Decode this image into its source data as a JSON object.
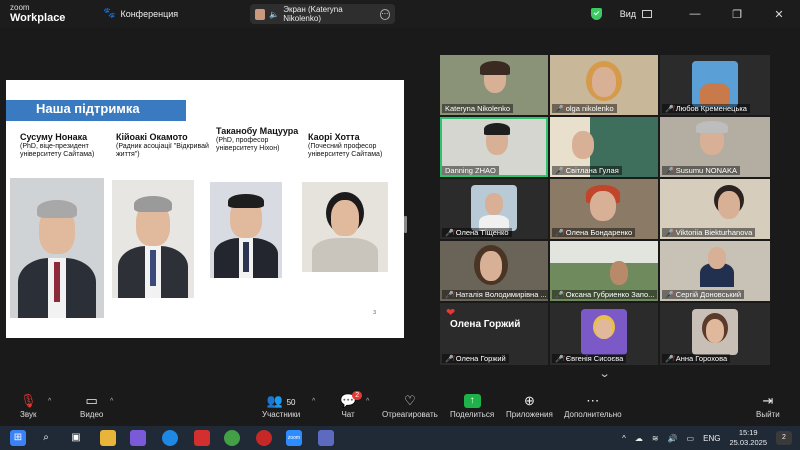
{
  "app": {
    "logo_top": "zoom",
    "logo_bottom": "Workplace",
    "meeting_label": "Конференция"
  },
  "share_pill": {
    "label": "Экран (Kateryna Nikolenko)",
    "more": "⋯"
  },
  "titlebar": {
    "view_label": "Вид"
  },
  "slide": {
    "title": "Наша підтримка",
    "page": "3",
    "people": [
      {
        "name": "Сусуму Нонака",
        "desc": "(PhD, віце-президент університету Сайтама)"
      },
      {
        "name": "Кійоакі Окамото",
        "desc": "(Радник асоціації \"Відкривай життя\")"
      },
      {
        "name": "Таканобу Мацуура",
        "desc": "(PhD, професор університету Ніхон)"
      },
      {
        "name": "Каорі Хотта",
        "desc": "(Почесний професор університету Сайтама)"
      }
    ]
  },
  "participants": [
    {
      "name": "Kateryna Nikolenko",
      "muted": false
    },
    {
      "name": "olga nikolenko",
      "muted": true
    },
    {
      "name": "Любов Кременецька",
      "muted": true
    },
    {
      "name": "Danning ZHAO",
      "muted": false
    },
    {
      "name": "Світлана Гулая",
      "muted": true
    },
    {
      "name": "Susumu NONAKA",
      "muted": true
    },
    {
      "name": "Олена Тіщенко",
      "muted": true
    },
    {
      "name": "Олена Бондаренко",
      "muted": true
    },
    {
      "name": "Viktoriia Biekturhanova",
      "muted": true
    },
    {
      "name": "Наталія Володимирівна ...",
      "muted": true
    },
    {
      "name": "Оксана Губриенко Запо...",
      "muted": true
    },
    {
      "name": "Сергій Доновський",
      "muted": true
    },
    {
      "name": "Олена Горжий",
      "muted": true,
      "display_name": "Олена Горжий"
    },
    {
      "name": "Євгенія Сисоєва",
      "muted": true
    },
    {
      "name": "Анна Горохова",
      "muted": true
    }
  ],
  "toolbar": {
    "audio": "Звук",
    "video": "Видео",
    "participants": "Участники",
    "participants_count": "50",
    "chat": "Чат",
    "chat_badge": "2",
    "react": "Отреагировать",
    "share": "Поделиться",
    "apps": "Приложения",
    "more": "Дополнительно",
    "leave": "Выйти"
  },
  "taskbar": {
    "lang": "ENG",
    "time": "15:19",
    "date": "25.03.2025",
    "notif_count": "2"
  }
}
